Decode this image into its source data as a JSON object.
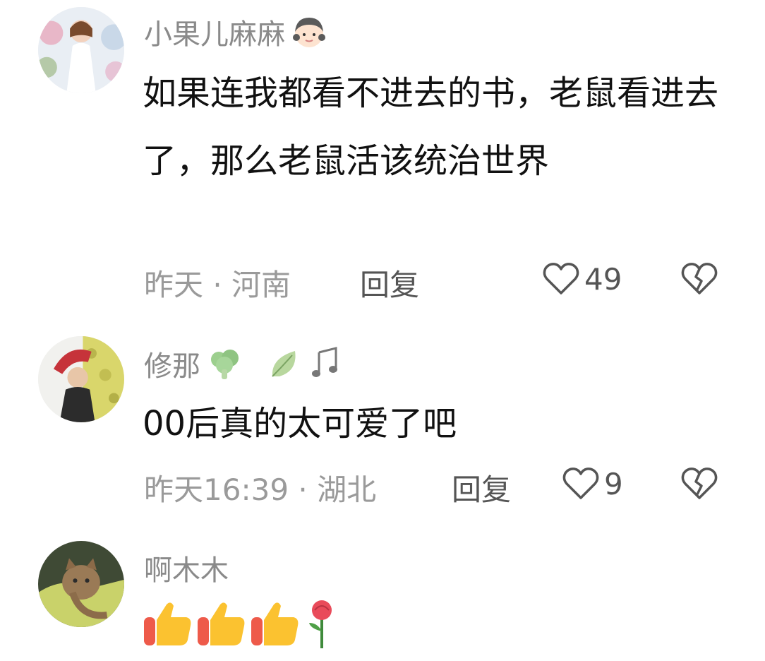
{
  "comments": [
    {
      "username": "小果儿麻麻",
      "text": "如果连我都看不进去的书，老鼠看进去了，那么老鼠活该统治世界",
      "time_location": "昨天 · 河南",
      "reply_label": "回复",
      "like_count": "49",
      "badge_icons": [
        "girl-face-icon"
      ]
    },
    {
      "username": "修那",
      "text": "00后真的太可爱了吧",
      "time_location": "昨天16:39 · 湖北",
      "reply_label": "回复",
      "like_count": "9",
      "badge_icons": [
        "broccoli-icon",
        "leaf-icon",
        "music-notes-icon"
      ]
    },
    {
      "username": "啊木木",
      "emoji_icons": [
        "thumbs-up-icon",
        "thumbs-up-icon",
        "thumbs-up-icon",
        "rose-icon"
      ]
    }
  ],
  "colors": {
    "username": "#8a8a8a",
    "text": "#111111",
    "meta": "#9a9a9a",
    "action": "#555555"
  }
}
